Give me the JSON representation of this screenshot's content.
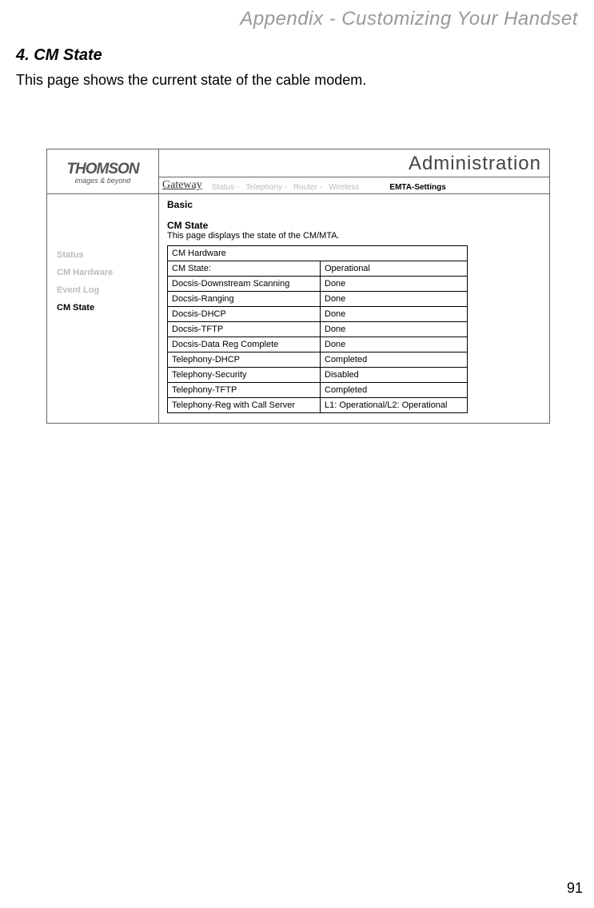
{
  "doc": {
    "chapter": "Appendix - Customizing Your Handset",
    "heading": "4. CM State",
    "description": "This page shows the current state of the cable modem.",
    "page_number": "91"
  },
  "logo": {
    "brand": "THOMSON",
    "tagline": "images & beyond"
  },
  "header": {
    "title": "Administration",
    "gateway_label": "Gateway"
  },
  "nav": {
    "items": [
      {
        "label": "Status -",
        "active": false
      },
      {
        "label": "Telephony -",
        "active": false
      },
      {
        "label": "Router -",
        "active": false
      },
      {
        "label": "Wireless",
        "active": false
      }
    ],
    "active_label": "EMTA-Settings"
  },
  "sidebar": {
    "items": [
      {
        "label": "Status",
        "active": false
      },
      {
        "label": "CM Hardware",
        "active": false
      },
      {
        "label": "Event Log",
        "active": false
      },
      {
        "label": "CM State",
        "active": true
      }
    ]
  },
  "content": {
    "basic": "Basic",
    "title": "CM State",
    "subtitle": "This page displays the state of the CM/MTA.",
    "table": {
      "header": "CM Hardware",
      "rows": [
        {
          "label": "CM State:",
          "value": "Operational"
        },
        {
          "label": "Docsis-Downstream Scanning",
          "value": "Done"
        },
        {
          "label": "Docsis-Ranging",
          "value": "Done"
        },
        {
          "label": "Docsis-DHCP",
          "value": "Done"
        },
        {
          "label": "Docsis-TFTP",
          "value": "Done"
        },
        {
          "label": "Docsis-Data Reg Complete",
          "value": "Done"
        },
        {
          "label": "Telephony-DHCP",
          "value": "Completed"
        },
        {
          "label": "Telephony-Security",
          "value": "Disabled"
        },
        {
          "label": "Telephony-TFTP",
          "value": "Completed"
        },
        {
          "label": "Telephony-Reg with Call Server",
          "value": "L1: Operational/L2: Operational"
        }
      ]
    }
  }
}
